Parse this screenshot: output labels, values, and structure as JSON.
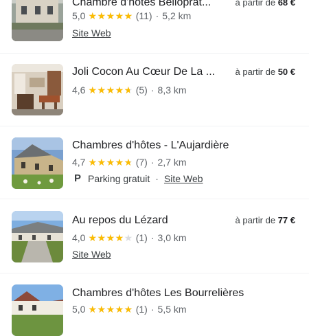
{
  "results": [
    {
      "title": "Chambre d'hôtes Belloprat...",
      "price_prefix": "à partir de",
      "price_value": "68 €",
      "rating": "5,0",
      "rating_value": 5.0,
      "reviews": "(11)",
      "distance": "5,2 km",
      "link": "Site Web",
      "thumb_icon": "house-photo"
    },
    {
      "title": "Joli Cocon Au Cœur De La ...",
      "price_prefix": "à partir de",
      "price_value": "50 €",
      "rating": "4,6",
      "rating_value": 4.6,
      "reviews": "(5)",
      "distance": "8,3 km",
      "link": "Site Web",
      "thumb_icon": "kitchen-photo"
    },
    {
      "title": "Chambres d'hôtes - L'Aujardière",
      "rating": "4,7",
      "rating_value": 4.7,
      "reviews": "(7)",
      "distance": "2,7 km",
      "amenity": "Parking gratuit",
      "link": "Site Web",
      "thumb_icon": "stone-house-photo"
    },
    {
      "title": "Au repos du Lézard",
      "price_prefix": "à partir de",
      "price_value": "77 €",
      "rating": "4,0",
      "rating_value": 4.0,
      "reviews": "(1)",
      "distance": "3,0 km",
      "link": "Site Web",
      "thumb_icon": "farmhouse-photo"
    },
    {
      "title": "Chambres d'hôtes Les Bourrelières",
      "rating": "5,0",
      "rating_value": 5.0,
      "reviews": "(1)",
      "distance": "5,5 km",
      "thumb_icon": "house-roof-photo"
    }
  ],
  "separator": "·",
  "colors": {
    "star": "#fbbc04",
    "star_empty": "#dadce0",
    "text": "#202124",
    "muted": "#5f6368"
  }
}
